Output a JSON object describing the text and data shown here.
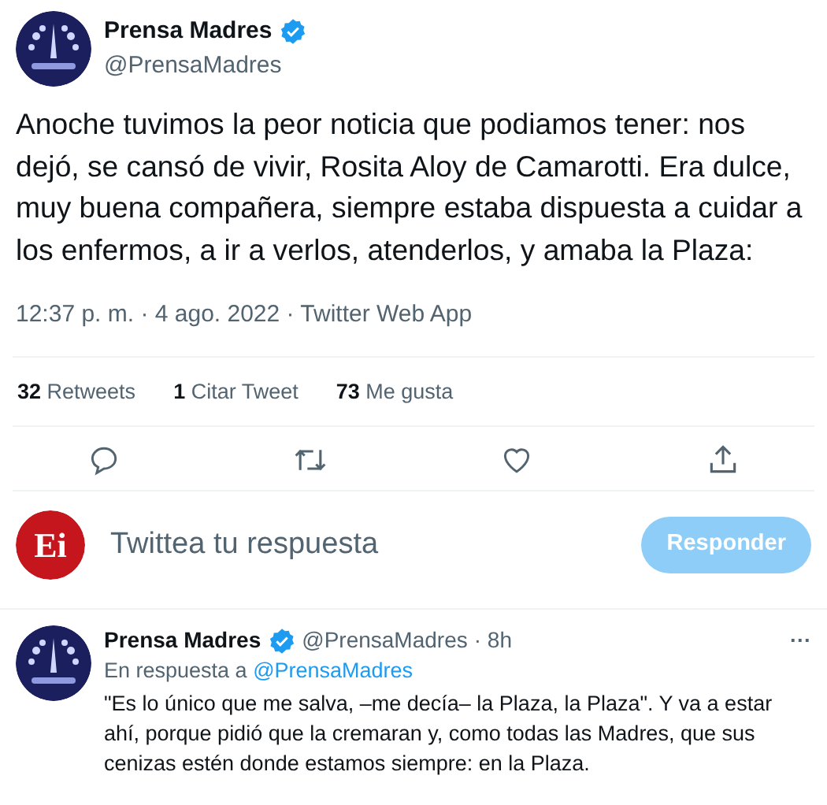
{
  "tweet": {
    "author": {
      "name": "Prensa Madres",
      "handle": "@PrensaMadres",
      "verified": true
    },
    "text": "Anoche tuvimos la peor noticia que podiamos tener: nos dejó, se cansó de vivir, Rosita Aloy de Camarotti. Era dulce, muy buena compañera, siempre estaba dispuesta a cuidar a los enfermos, a ir a verlos, atenderlos, y amaba la Plaza:",
    "meta": "12:37 p. m. · 4 ago. 2022 · Twitter Web App",
    "stats": [
      {
        "count": "32",
        "label": "Retweets"
      },
      {
        "count": "1",
        "label": "Citar Tweet"
      },
      {
        "count": "73",
        "label": "Me gusta"
      }
    ],
    "actions": [
      {
        "kind": "reply"
      },
      {
        "kind": "retweet"
      },
      {
        "kind": "like"
      },
      {
        "kind": "share"
      }
    ]
  },
  "composer": {
    "avatar_text": "Ei",
    "placeholder": "Twittea tu respuesta",
    "button": "Responder",
    "disabled": true
  },
  "reply": {
    "author": {
      "name": "Prensa Madres",
      "handle": "@PrensaMadres",
      "verified": true
    },
    "time": "· 8h",
    "more": "···",
    "in_reply_prefix": "En respuesta a",
    "in_reply_to": "@PrensaMadres",
    "text": "\"Es lo único que me salva, –me decía– la Plaza, la Plaza\". Y va a estar ahí, porque pidió que la cremaran y, como todas las Madres, que sus cenizas estén donde estamos siempre: en la Plaza."
  }
}
